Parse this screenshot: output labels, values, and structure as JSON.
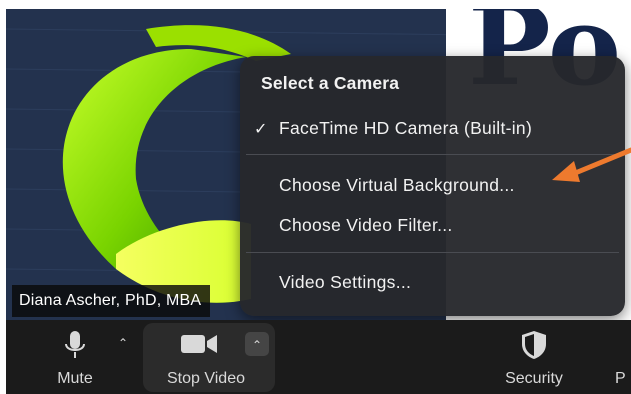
{
  "participant": {
    "name": "Diana Ascher, PhD, MBA"
  },
  "background_text": "Po",
  "camera_menu": {
    "header": "Select a Camera",
    "selected_camera": "FaceTime HD Camera (Built-in)",
    "items": [
      "Choose Virtual Background...",
      "Choose Video Filter...",
      "Video Settings..."
    ]
  },
  "toolbar": {
    "mute_label": "Mute",
    "stop_video_label": "Stop Video",
    "security_label": "Security",
    "partial_label": "P"
  },
  "colors": {
    "arrow": "#ee7a2e",
    "menu_bg": "#26282c",
    "toolbar_bg": "#1b1b1b"
  }
}
